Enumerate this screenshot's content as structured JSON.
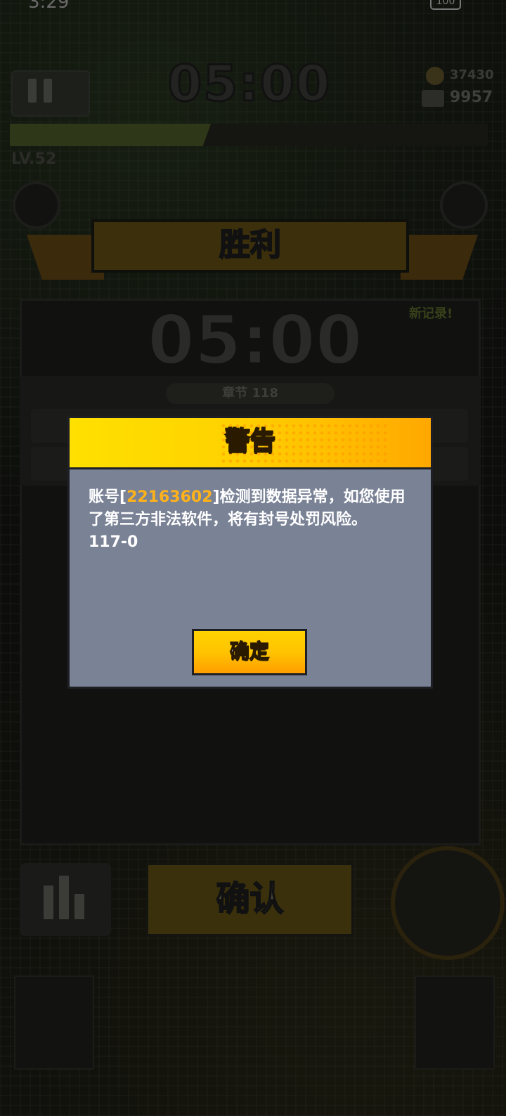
{
  "status_bar": {
    "time": "3:29",
    "battery": "100"
  },
  "hud": {
    "timer": "05:00",
    "coins": "37430",
    "gems": "9957",
    "level": "LV.52",
    "xp_progress_fraction": 0.42
  },
  "result": {
    "banner": "胜利",
    "new_record": "新记录!",
    "time": "05:00",
    "chapter": "章节 118",
    "confirm_label": "确认"
  },
  "dialog": {
    "title": "警告",
    "message_prefix": "账号[",
    "account_id": "22163602",
    "message_suffix": "]检测到数据异常，如您使用了第三方非法软件，将有封号处罚风险。",
    "code": "117-0",
    "ok_label": "确定"
  },
  "colors": {
    "dialog_body": "#7a8296",
    "dialog_header": "#ffd400",
    "account_highlight": "#ffb21a",
    "button_yellow": "#ffc400"
  }
}
